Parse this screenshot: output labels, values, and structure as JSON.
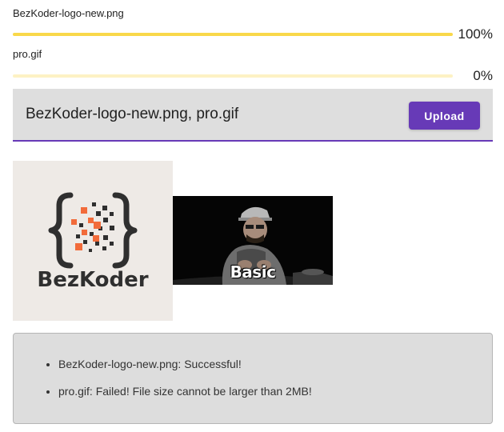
{
  "uploads": [
    {
      "name": "BezKoder-logo-new.png",
      "progress_text": "100%",
      "progress": 100
    },
    {
      "name": "pro.gif",
      "progress_text": "0%",
      "progress": 0
    }
  ],
  "select_bar": {
    "selected_files": "BezKoder-logo-new.png, pro.gif",
    "upload_label": "Upload"
  },
  "previews": {
    "logo_text": "BezKoder",
    "gif_caption": "Basic"
  },
  "messages": [
    "BezKoder-logo-new.png: Successful!",
    "pro.gif: Failed! File size cannot be larger than 2MB!"
  ],
  "colors": {
    "accent": "#673ab7",
    "progress_fill": "#f9d84a",
    "progress_track": "#fdf2c4",
    "logo_orange": "#f26b3a",
    "logo_dark": "#2f2f2f"
  },
  "icons": {
    "logo": "bezkoder-logo-icon"
  }
}
